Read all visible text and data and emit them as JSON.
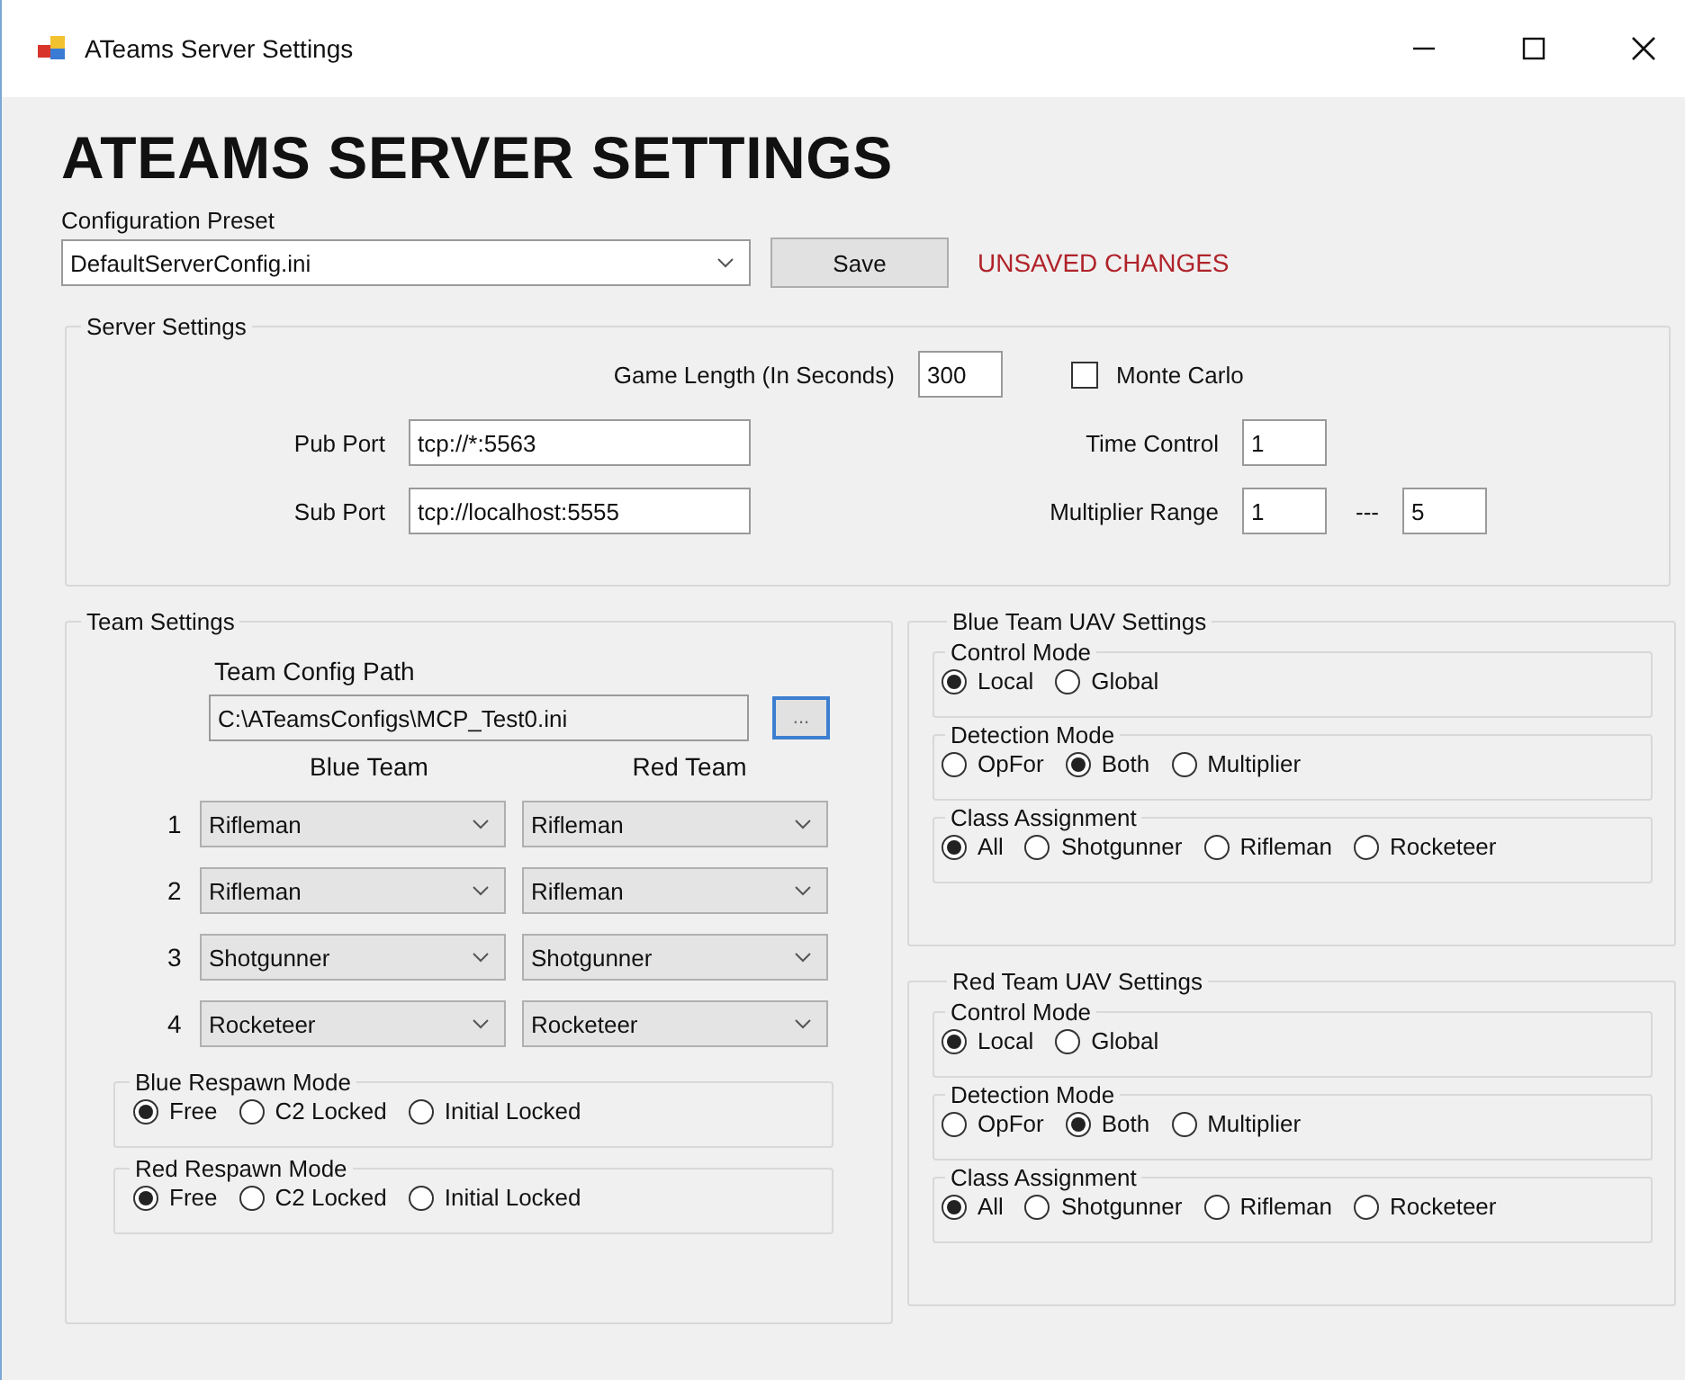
{
  "window": {
    "title": "ATeams Server Settings"
  },
  "heading": "ATEAMS SERVER SETTINGS",
  "preset": {
    "label": "Configuration Preset",
    "value": "DefaultServerConfig.ini",
    "save_button": "Save",
    "status": "UNSAVED CHANGES"
  },
  "server_settings": {
    "title": "Server Settings",
    "game_length": {
      "label": "Game Length (In Seconds)",
      "value": "300"
    },
    "monte_carlo": {
      "label": "Monte Carlo",
      "checked": false
    },
    "pub_port": {
      "label": "Pub Port",
      "value": "tcp://*:5563"
    },
    "sub_port": {
      "label": "Sub Port",
      "value": "tcp://localhost:5555"
    },
    "time_control": {
      "label": "Time Control",
      "value": "1"
    },
    "multiplier_range": {
      "label": "Multiplier Range",
      "min": "1",
      "separator": "---",
      "max": "5"
    }
  },
  "team_settings": {
    "title": "Team Settings",
    "config_path": {
      "label": "Team Config Path",
      "value": "C:\\ATeamsConfigs\\MCP_Test0.ini",
      "browse_button": "..."
    },
    "columns": [
      "Blue Team",
      "Red Team"
    ],
    "slots": [
      {
        "number": "1",
        "blue": "Rifleman",
        "red": "Rifleman"
      },
      {
        "number": "2",
        "blue": "Rifleman",
        "red": "Rifleman"
      },
      {
        "number": "3",
        "blue": "Shotgunner",
        "red": "Shotgunner"
      },
      {
        "number": "4",
        "blue": "Rocketeer",
        "red": "Rocketeer"
      }
    ],
    "respawn": [
      {
        "title": "Blue Respawn Mode",
        "options": [
          {
            "label": "Free",
            "selected": true
          },
          {
            "label": "C2 Locked",
            "selected": false
          },
          {
            "label": "Initial Locked",
            "selected": false
          }
        ]
      },
      {
        "title": "Red Respawn Mode",
        "options": [
          {
            "label": "Free",
            "selected": true
          },
          {
            "label": "C2 Locked",
            "selected": false
          },
          {
            "label": "Initial Locked",
            "selected": false
          }
        ]
      }
    ]
  },
  "uav": [
    {
      "title": "Blue Team UAV Settings",
      "groups": [
        {
          "title": "Control Mode",
          "options": [
            {
              "label": "Local",
              "selected": true
            },
            {
              "label": "Global",
              "selected": false
            }
          ]
        },
        {
          "title": "Detection Mode",
          "options": [
            {
              "label": "OpFor",
              "selected": false
            },
            {
              "label": "Both",
              "selected": true
            },
            {
              "label": "Multiplier",
              "selected": false
            }
          ]
        },
        {
          "title": "Class Assignment",
          "options": [
            {
              "label": "All",
              "selected": true
            },
            {
              "label": "Shotgunner",
              "selected": false
            },
            {
              "label": "Rifleman",
              "selected": false
            },
            {
              "label": "Rocketeer",
              "selected": false
            }
          ]
        }
      ]
    },
    {
      "title": "Red Team UAV Settings",
      "groups": [
        {
          "title": "Control Mode",
          "options": [
            {
              "label": "Local",
              "selected": true
            },
            {
              "label": "Global",
              "selected": false
            }
          ]
        },
        {
          "title": "Detection Mode",
          "options": [
            {
              "label": "OpFor",
              "selected": false
            },
            {
              "label": "Both",
              "selected": true
            },
            {
              "label": "Multiplier",
              "selected": false
            }
          ]
        },
        {
          "title": "Class Assignment",
          "options": [
            {
              "label": "All",
              "selected": true
            },
            {
              "label": "Shotgunner",
              "selected": false
            },
            {
              "label": "Rifleman",
              "selected": false
            },
            {
              "label": "Rocketeer",
              "selected": false
            }
          ]
        }
      ]
    }
  ]
}
